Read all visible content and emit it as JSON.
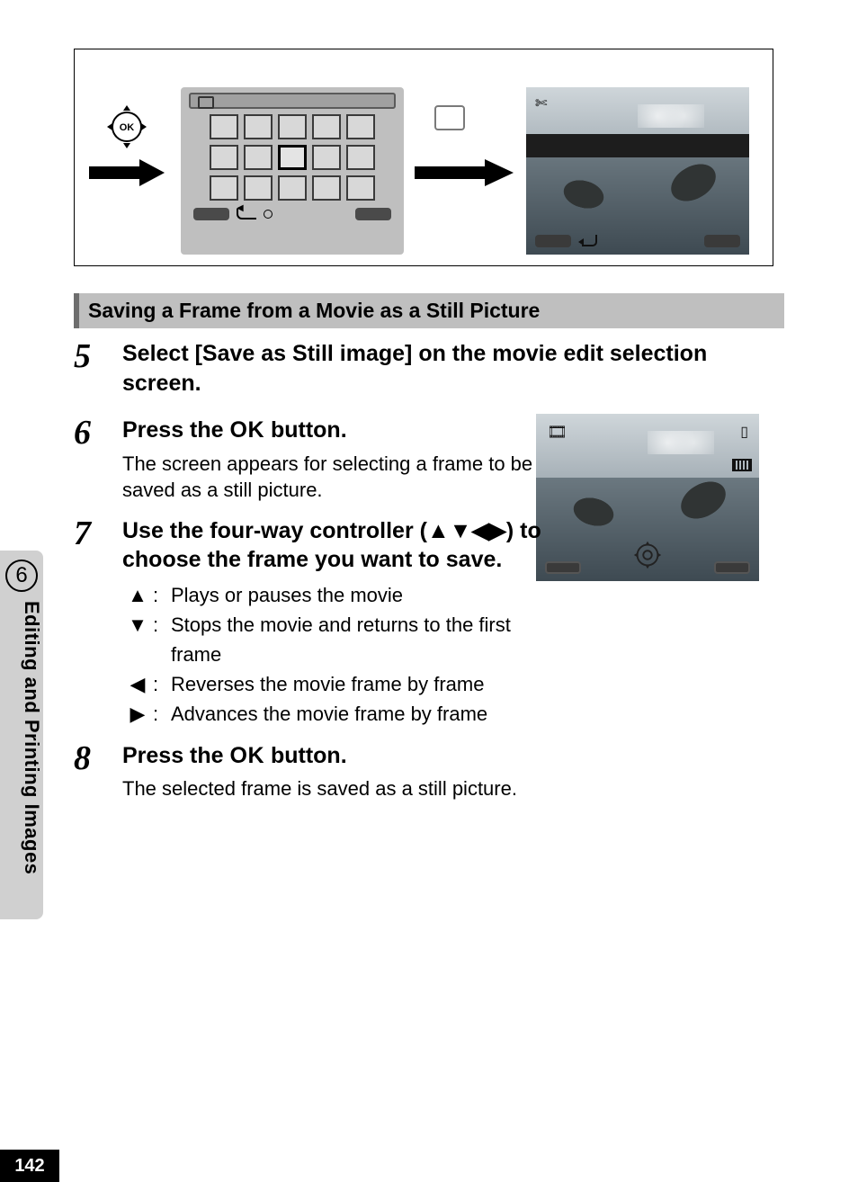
{
  "page_number": "142",
  "side_tab": {
    "chapter_number": "6",
    "title": "Editing and Printing Images"
  },
  "section_heading": "Saving a Frame from a Movie as a Still Picture",
  "steps": {
    "s5": {
      "num": "5",
      "title": "Select [Save as Still image] on the movie edit selection screen."
    },
    "s6": {
      "num": "6",
      "title_pre": "Press the ",
      "title_ok": "OK",
      "title_post": " button.",
      "desc": "The screen appears for selecting a frame to be saved as a still picture."
    },
    "s7": {
      "num": "7",
      "title": "Use the four-way controller (▲▼◀▶) to choose the frame you want to save.",
      "arrows": {
        "up": {
          "glyph": "▲",
          "text": "Plays or pauses the movie"
        },
        "down": {
          "glyph": "▼",
          "text": "Stops the movie and returns to the first frame"
        },
        "left": {
          "glyph": "◀",
          "text": "Reverses the movie frame by frame"
        },
        "right": {
          "glyph": "▶",
          "text": "Advances the movie frame by frame"
        }
      }
    },
    "s8": {
      "num": "8",
      "title_pre": "Press the ",
      "title_ok": "OK",
      "title_post": " button.",
      "desc": "The selected frame is saved as a still picture."
    }
  },
  "ok_button_label": "OK"
}
